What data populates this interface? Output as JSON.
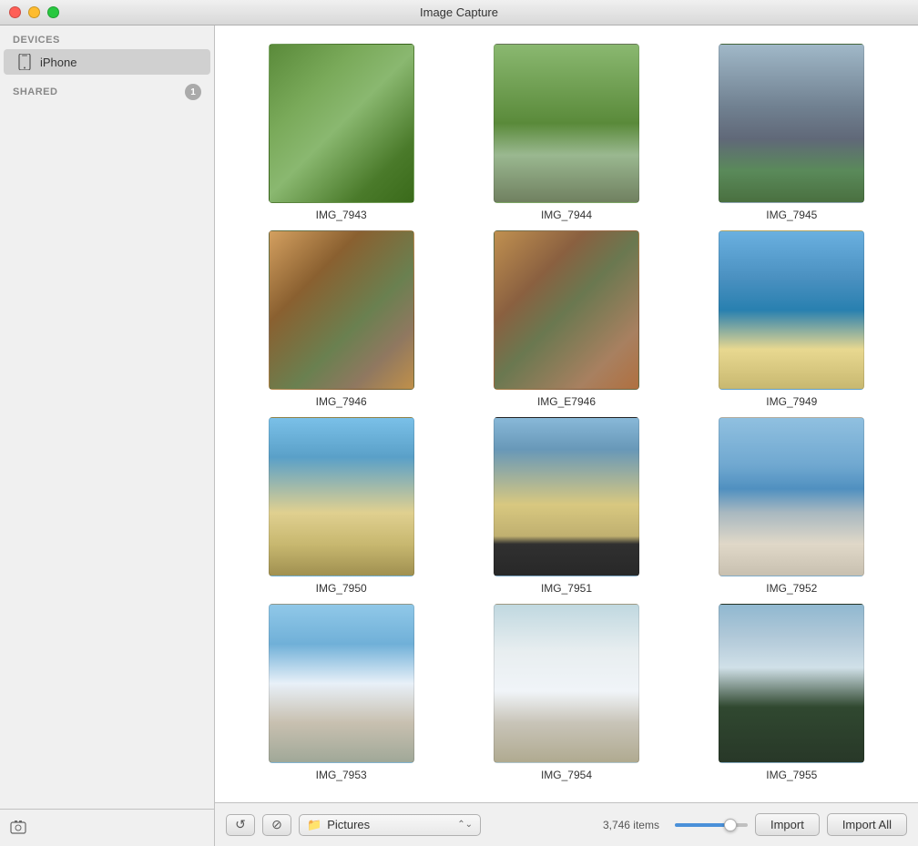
{
  "window": {
    "title": "Image Capture",
    "buttons": {
      "close": "close",
      "minimize": "minimize",
      "maximize": "maximize"
    }
  },
  "sidebar": {
    "devices_label": "DEVICES",
    "shared_label": "SHARED",
    "shared_count": "1",
    "iphone_label": "iPhone"
  },
  "photos": [
    {
      "name": "IMG_7943",
      "color_class": "golf-1"
    },
    {
      "name": "IMG_7944",
      "color_class": "golf-2"
    },
    {
      "name": "IMG_7945",
      "color_class": "golf-3"
    },
    {
      "name": "IMG_7946",
      "color_class": "kangaroo-1"
    },
    {
      "name": "IMG_E7946",
      "color_class": "kangaroo-2"
    },
    {
      "name": "IMG_7949",
      "color_class": "beach-blue"
    },
    {
      "name": "IMG_7950",
      "color_class": "beach-1"
    },
    {
      "name": "IMG_7951",
      "color_class": "beach-2"
    },
    {
      "name": "IMG_7952",
      "color_class": "beach-3"
    },
    {
      "name": "IMG_7953",
      "color_class": "city-1"
    },
    {
      "name": "IMG_7954",
      "color_class": "city-2"
    },
    {
      "name": "IMG_7955",
      "color_class": "trees-1"
    }
  ],
  "bottom_bar": {
    "rotate_label": "↺",
    "delete_label": "⊘",
    "destination_label": "Pictures",
    "items_count": "3,746 items",
    "import_label": "Import",
    "import_all_label": "Import All"
  }
}
